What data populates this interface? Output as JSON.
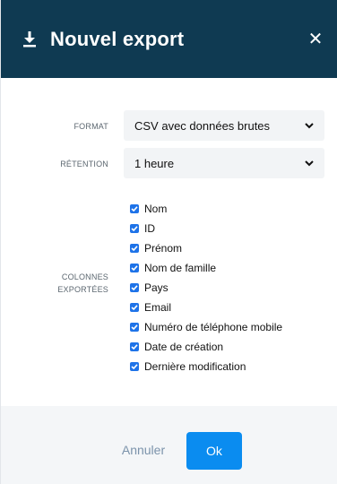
{
  "header": {
    "title": "Nouvel export",
    "icon": "download-icon",
    "close_icon": "close-icon",
    "close_glyph": "✕",
    "background": "#0f3a52"
  },
  "form": {
    "format": {
      "label": "FORMAT",
      "value": "CSV avec données brutes"
    },
    "retention": {
      "label": "RÉTENTION",
      "value": "1 heure"
    },
    "columns": {
      "label_line1": "COLONNES",
      "label_line2": "EXPORTÉES",
      "items": [
        {
          "label": "Nom",
          "checked": true
        },
        {
          "label": "ID",
          "checked": true
        },
        {
          "label": "Prénom",
          "checked": true
        },
        {
          "label": "Nom de famille",
          "checked": true
        },
        {
          "label": "Pays",
          "checked": true
        },
        {
          "label": "Email",
          "checked": true
        },
        {
          "label": "Numéro de téléphone mobile",
          "checked": true
        },
        {
          "label": "Date de création",
          "checked": true
        },
        {
          "label": "Dernière modification",
          "checked": true
        }
      ]
    }
  },
  "footer": {
    "cancel_label": "Annuler",
    "ok_label": "Ok",
    "ok_color": "#0a8cf0"
  }
}
